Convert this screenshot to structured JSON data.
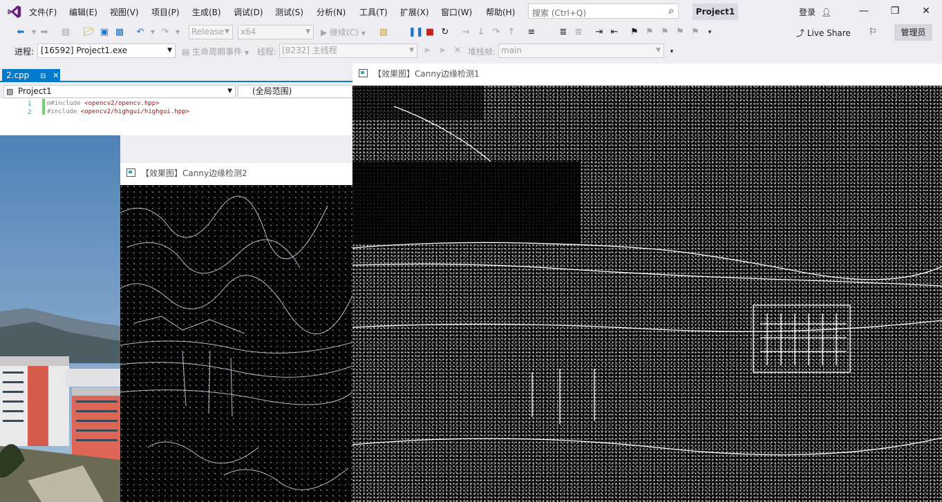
{
  "menu": {
    "items": [
      "文件(F)",
      "编辑(E)",
      "视图(V)",
      "项目(P)",
      "生成(B)",
      "调试(D)",
      "测试(S)",
      "分析(N)",
      "工具(T)",
      "扩展(X)",
      "窗口(W)",
      "帮助(H)"
    ],
    "search_placeholder": "搜索 (Ctrl+Q)",
    "project_name": "Project1",
    "login_label": "登录"
  },
  "toolbar": {
    "configuration": "Release",
    "platform": "x64",
    "continue_label": "继续(C)",
    "live_share_label": "Live Share",
    "admin_label": "管理员"
  },
  "debug": {
    "process_label": "进程:",
    "process_value": "[16592] Project1.exe",
    "lifecycle_label": "生命周期事件",
    "thread_label": "线程:",
    "thread_value": "[8232] 主线程",
    "stack_label": "堆栈帧:",
    "stack_value": "main"
  },
  "editor": {
    "tab_label": "2.cpp",
    "nav_project": "Project1",
    "nav_scope": "(全局范围)",
    "lines": [
      {
        "num": "1",
        "prefix": "⊟#include ",
        "include": "<opencv2/opencv.hpp>"
      },
      {
        "num": "2",
        "prefix": " #include ",
        "include": "<opencv2/highgui/highgui.hpp>"
      }
    ]
  },
  "windows": {
    "canny1_title": "【效果图】Canny边缘检测1",
    "canny2_title": "【效果图】Canny边缘检测2"
  },
  "colors": {
    "accent": "#007acc",
    "chrome": "#eeeef2"
  }
}
